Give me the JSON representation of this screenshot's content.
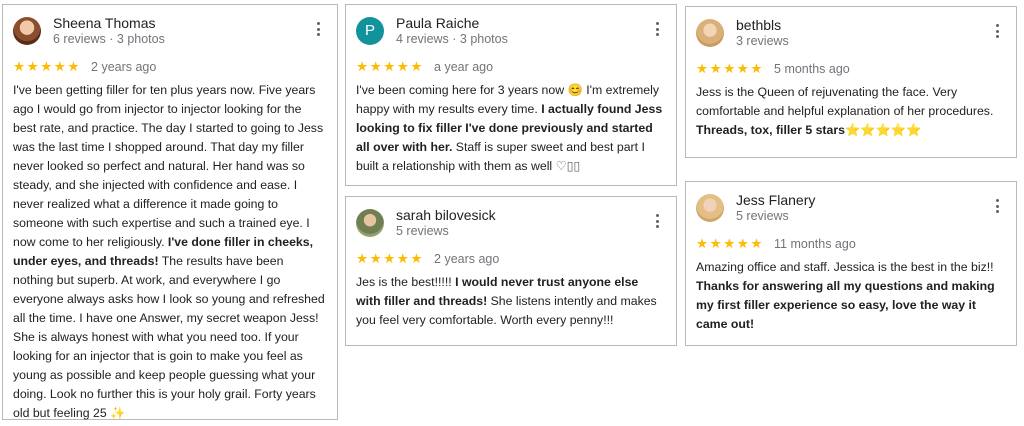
{
  "star_glyphs": "★★★★★",
  "reviews": [
    {
      "name": "Sheena Thomas",
      "meta": "6 reviews · 3 photos",
      "date": "2 years ago",
      "text1": "I've been getting filler for ten plus years now. Five years ago I would go from injector to injector looking for the best rate, and practice. The day I started to going to Jess was the last time I shopped around. That day my filler never looked so perfect and natural. Her hand was so steady, and she injected with confidence and ease. I never realized what a difference it made going to someone with such expertise and such a trained eye. I now come to her religiously. ",
      "bold": "I've done filler in cheeks, under eyes, and threads!",
      "text2": " The results have been nothing but superb. At work, and everywhere I go everyone always asks how I look so young and refreshed all the time. I have one Answer, my secret weapon Jess! She is always honest with what you need too. If your looking for an injector that is goin to make you feel as young as possible and keep people guessing what your doing. Look no further this is your holy grail. Forty years old but feeling 25 ",
      "emoji": "✨"
    },
    {
      "initial": "P",
      "name": "Paula Raiche",
      "meta": "4 reviews · 3 photos",
      "date": "a year ago",
      "text1": "I've been coming here for 3 years now ",
      "emoji": "😊",
      "text1b": " I'm extremely happy with my results every time. ",
      "bold": "I actually found Jess looking to fix filler I've done previously and started all over with her.",
      "text2": " Staff is super sweet and best part I built a relationship with them as well ",
      "tail": "♡▯▯"
    },
    {
      "name": "sarah bilovesick",
      "meta": "5 reviews",
      "date": "2 years ago",
      "text1": "Jes is the best!!!!! ",
      "bold": "I would never trust anyone else with filler and threads!",
      "text2": " She listens intently and makes you feel very comfortable. Worth every penny!!!"
    },
    {
      "name": "bethbls",
      "meta": "3 reviews",
      "date": "5 months ago",
      "text1": "Jess is the Queen of rejuvenating the face. Very comfortable and helpful explanation of her procedures. ",
      "bold": "Threads, tox, filler 5 stars",
      "emoji": "⭐⭐⭐⭐⭐"
    },
    {
      "name": "Jess Flanery",
      "meta": "5 reviews",
      "date": "11 months ago",
      "text1": "Amazing office and staff. Jessica is the best in the biz!!",
      "bold": "Thanks for answering all my questions and making my first filler experience so easy, love the way it came out!"
    }
  ]
}
